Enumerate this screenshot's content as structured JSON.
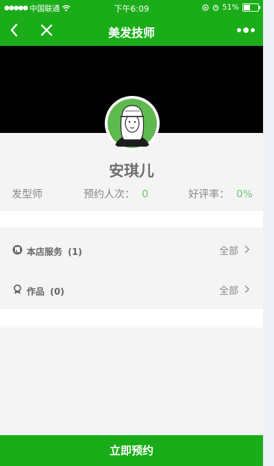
{
  "status_bar": {
    "carrier": "中国联通",
    "time": "下午6:09",
    "battery": "51%",
    "battery_level": 0.51
  },
  "navbar": {
    "title": "美发技师"
  },
  "profile": {
    "name": "安琪儿",
    "role": "发型师",
    "bookings_label": "预约人次：",
    "bookings_value": "0",
    "rating_label": "好评率：",
    "rating_value": "0%"
  },
  "sections": [
    {
      "label": "本店服务",
      "count": "(1)",
      "more": "全部",
      "icon": "shop-icon"
    },
    {
      "label": "作品",
      "count": "(0)",
      "more": "全部",
      "icon": "award-icon"
    }
  ],
  "footer": {
    "book_button": "立即预约"
  },
  "colors": {
    "brand_green": "#1aad19",
    "stat_value_green": "#6cc67a"
  }
}
